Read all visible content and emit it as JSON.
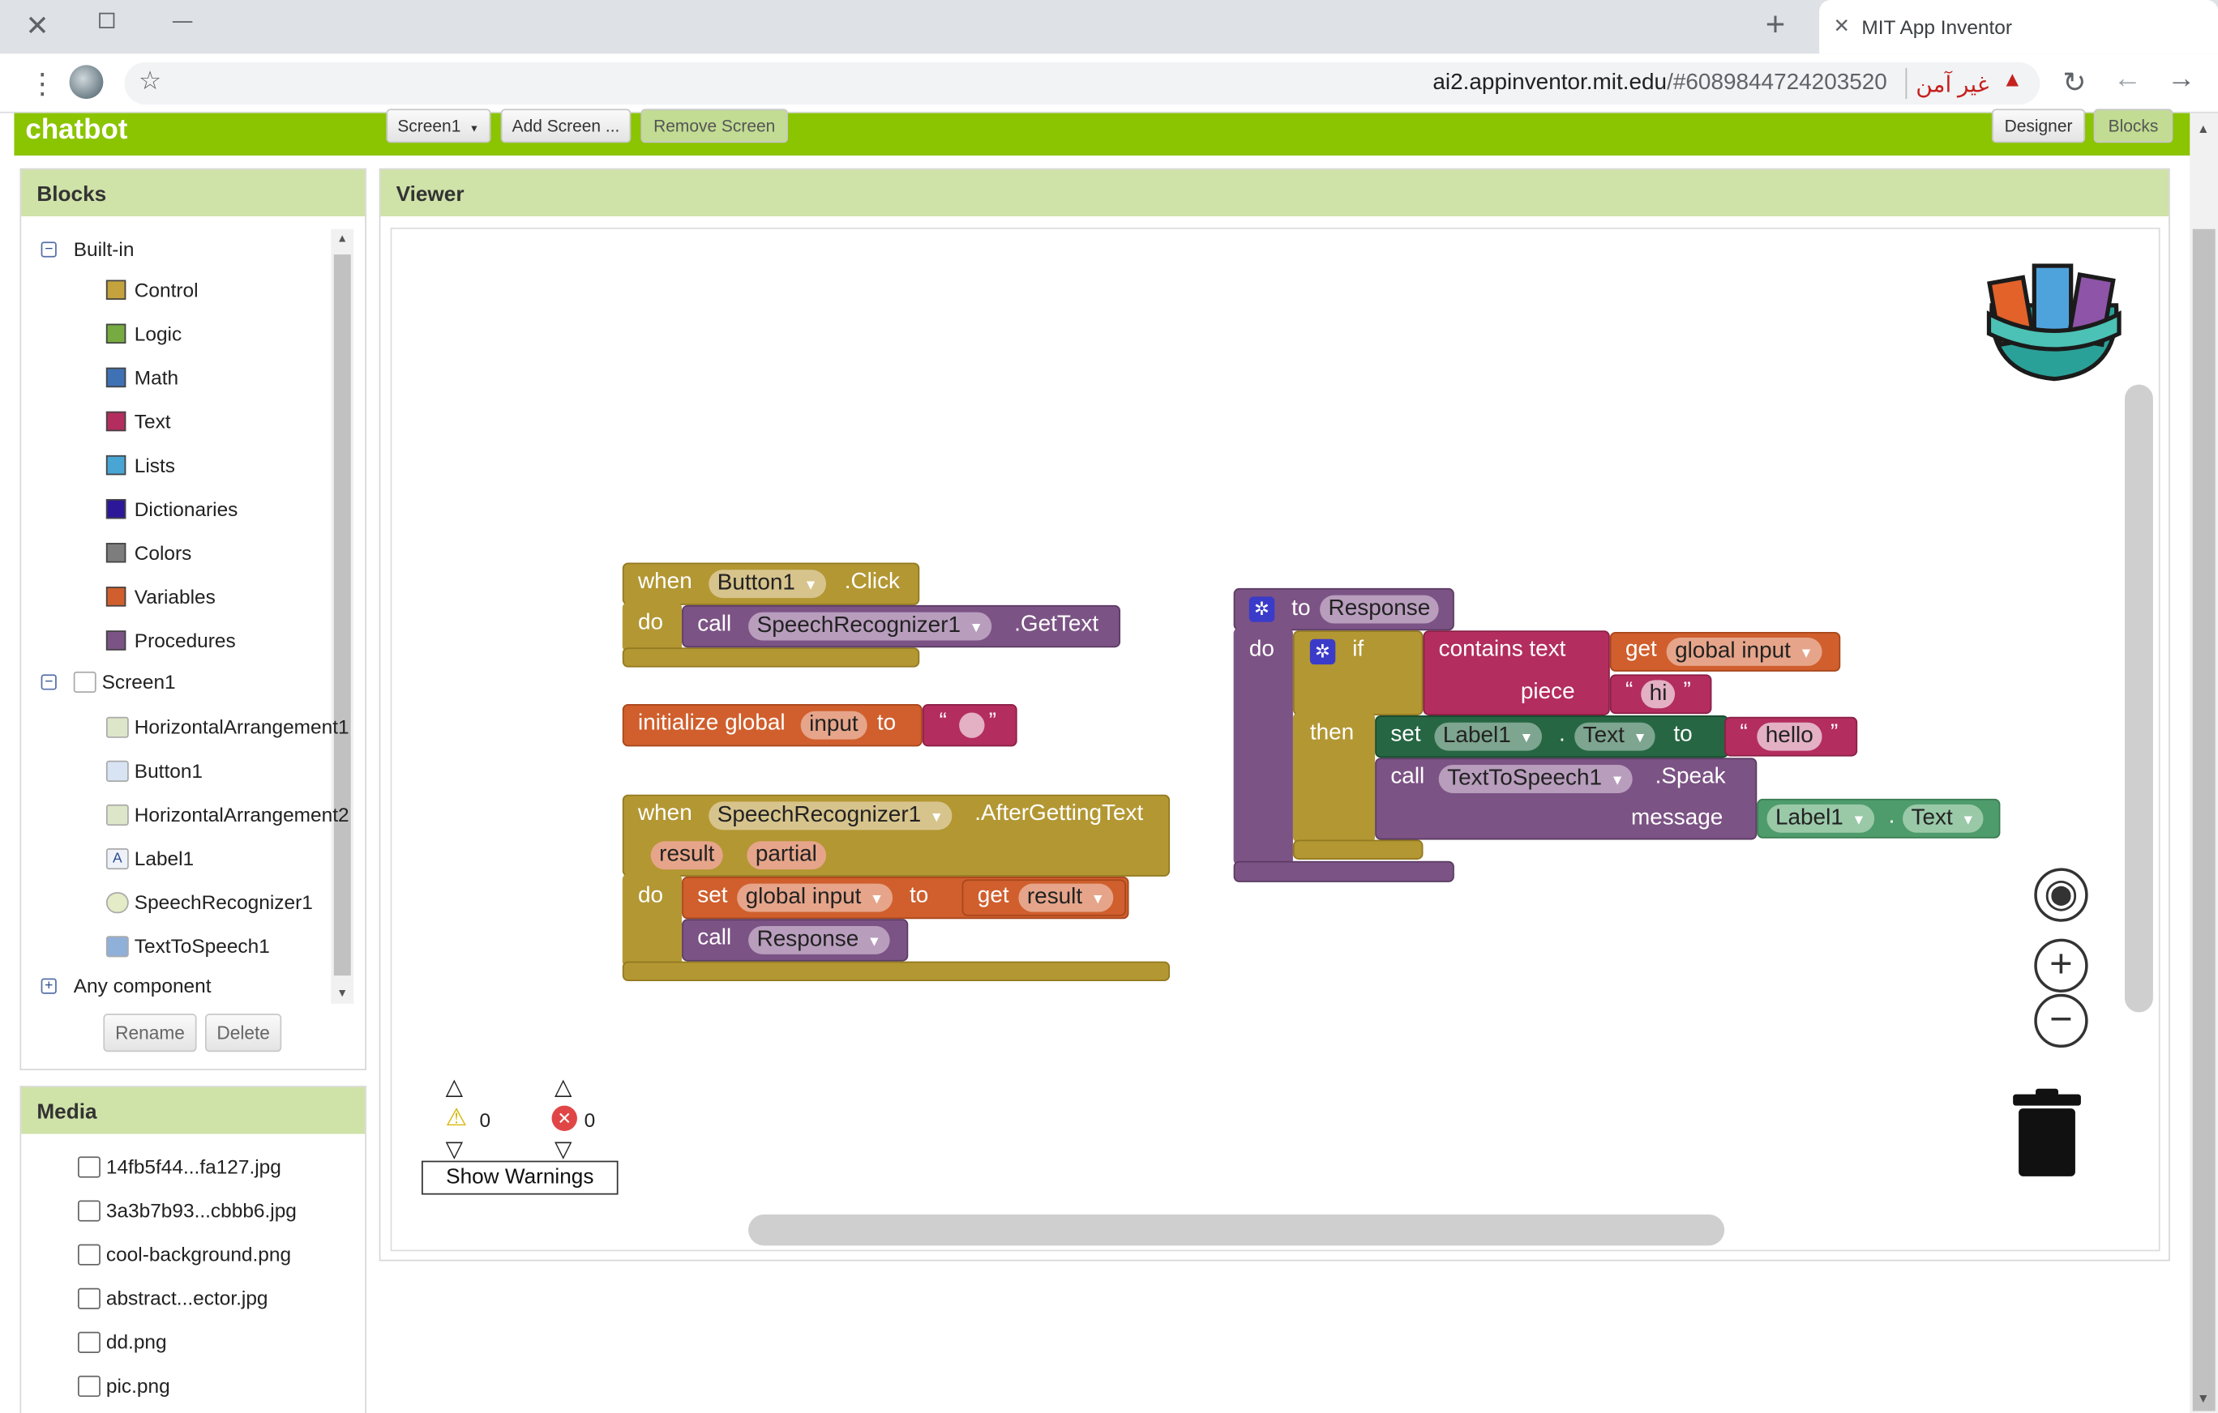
{
  "browser": {
    "tab_title": "MIT App Inventor",
    "url_host": "ai2.appinventor.mit.edu",
    "url_path": "/#6089844724203520",
    "security_text": "غير آمن"
  },
  "app": {
    "project_name": "chatbot",
    "screen_select": "Screen1",
    "add_screen": "Add Screen ...",
    "remove_screen": "Remove Screen",
    "designer": "Designer",
    "blocks": "Blocks"
  },
  "blocks_panel": {
    "title": "Blocks",
    "builtin": "Built-in",
    "builtin_items": [
      {
        "label": "Control",
        "color": "#c4a23d"
      },
      {
        "label": "Logic",
        "color": "#77ab41"
      },
      {
        "label": "Math",
        "color": "#3f71b5"
      },
      {
        "label": "Text",
        "color": "#b32d5e"
      },
      {
        "label": "Lists",
        "color": "#49a6d4"
      },
      {
        "label": "Dictionaries",
        "color": "#2d1799"
      },
      {
        "label": "Colors",
        "color": "#7d7d7d"
      },
      {
        "label": "Variables",
        "color": "#d05f2d"
      },
      {
        "label": "Procedures",
        "color": "#7c5385"
      }
    ],
    "screen": "Screen1",
    "components": [
      "HorizontalArrangement1",
      "Button1",
      "HorizontalArrangement2",
      "Label1",
      "SpeechRecognizer1",
      "TextToSpeech1"
    ],
    "any_component": "Any component",
    "rename": "Rename",
    "delete": "Delete"
  },
  "media_panel": {
    "title": "Media",
    "files": [
      "14fb5f44...fa127.jpg",
      "3a3b7b93...cbbb6.jpg",
      "cool-background.png",
      "abstract...ector.jpg",
      "dd.png",
      "pic.png"
    ]
  },
  "viewer": {
    "title": "Viewer",
    "warnings_count": "0",
    "errors_count": "0",
    "show_warnings": "Show Warnings"
  },
  "workspace": {
    "b1": {
      "when": "when",
      "component": "Button1",
      "event": ".Click",
      "do": "do",
      "call": "call",
      "target": "SpeechRecognizer1",
      "method": ".GetText"
    },
    "b2": {
      "label": "initialize global",
      "name": "input",
      "to": "to",
      "lq": "“",
      "rq": "”"
    },
    "b3": {
      "when": "when",
      "component": "SpeechRecognizer1",
      "event": ".AfterGettingText",
      "p1": "result",
      "p2": "partial",
      "do": "do",
      "set": "set",
      "var": "global input",
      "to": "to",
      "get": "get",
      "getvar": "result",
      "call": "call",
      "proc": "Response"
    },
    "b4": {
      "to": "to",
      "name": "Response",
      "do": "do",
      "if": "if",
      "then": "then",
      "contains": "contains text",
      "get": "get",
      "gvar": "global input",
      "piece": "piece",
      "piece_val": "hi",
      "set": "set",
      "label": "Label1",
      "dot": ".",
      "prop": "Text",
      "setto": "to",
      "hello": "hello",
      "call": "call",
      "tts": "TextToSpeech1",
      "speak": ".Speak",
      "message": "message",
      "msg_label": "Label1",
      "msg_prop": "Text",
      "lq": "“",
      "rq": "”"
    }
  }
}
